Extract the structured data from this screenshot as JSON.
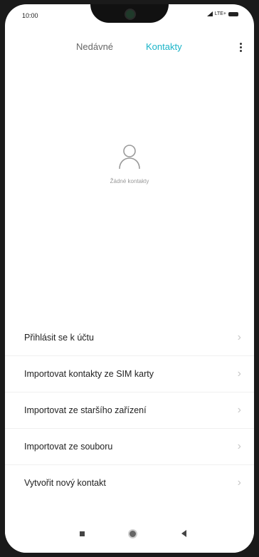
{
  "status_bar": {
    "time": "10:00",
    "network": "LTE+"
  },
  "tabs": {
    "recent": "Nedávné",
    "contacts": "Kontakty"
  },
  "empty_state": {
    "text": "Žádné kontakty"
  },
  "menu": {
    "items": [
      {
        "label": "Přihlásit se k účtu"
      },
      {
        "label": "Importovat kontakty ze SIM karty"
      },
      {
        "label": "Importovat ze staršího zařízení"
      },
      {
        "label": "Importovat ze souboru"
      },
      {
        "label": "Vytvořit nový kontakt"
      }
    ]
  },
  "colors": {
    "accent": "#1ab4c8"
  },
  "icons": [
    "signal-icon",
    "battery-icon",
    "more-vert-icon",
    "person-icon",
    "chevron-right-icon",
    "nav-recents-icon",
    "nav-home-icon",
    "nav-back-icon"
  ]
}
